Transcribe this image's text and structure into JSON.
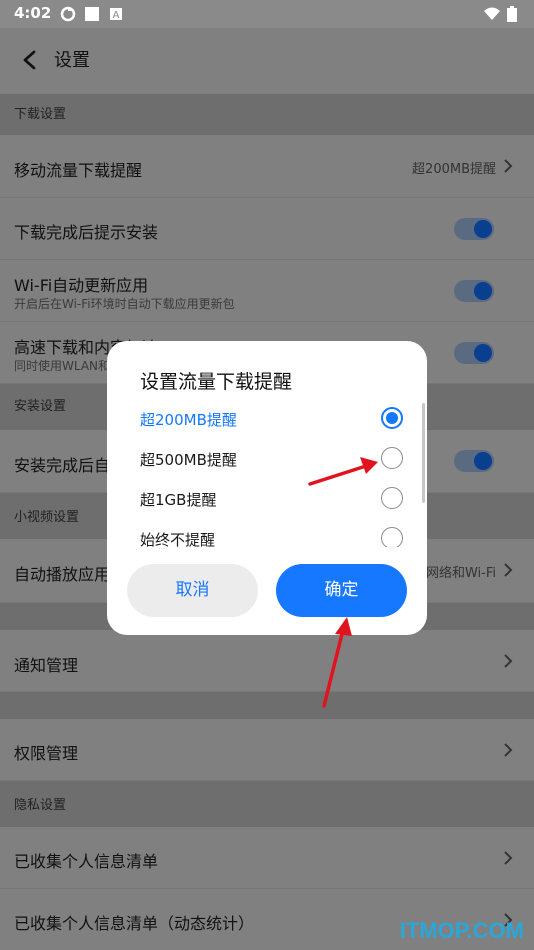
{
  "status_bar": {
    "time": "4:02",
    "icons": [
      "sync-icon",
      "square-icon",
      "a-icon",
      "wifi-icon",
      "battery-icon"
    ]
  },
  "header": {
    "title": "设置"
  },
  "sections": {
    "download": "下载设置",
    "install": "安装设置",
    "video": "小视频设置",
    "privacy": "隐私设置"
  },
  "rows": {
    "mobile_data": {
      "label": "移动流量下载提醒",
      "value": "超200MB提醒"
    },
    "prompt_install": {
      "label": "下载完成后提示安装"
    },
    "wifi_update": {
      "label": "Wi-Fi自动更新应用",
      "sub": "开启后在Wi-Fi环境时自动下载应用更新包"
    },
    "high_speed": {
      "label": "高速下载和内容加速",
      "sub": "同时使用WLAN和移动网络"
    },
    "install_done": {
      "label": "安装完成后自动删除安装包"
    },
    "autoplay": {
      "label": "自动播放应用",
      "value": "移动网络和Wi-Fi"
    },
    "notify": {
      "label": "通知管理"
    },
    "permission": {
      "label": "权限管理"
    },
    "personal_info": {
      "label": "已收集个人信息清单"
    },
    "personal_info_stats": {
      "label": "已收集个人信息清单（动态统计）"
    }
  },
  "dialog": {
    "title": "设置流量下载提醒",
    "options": [
      "超200MB提醒",
      "超500MB提醒",
      "超1GB提醒",
      "始终不提醒"
    ],
    "selected_index": 0,
    "cancel_label": "取消",
    "confirm_label": "确定"
  },
  "watermark": "ITMOP.COM",
  "colors": {
    "accent": "#1677ff",
    "annotation": "#e0141e"
  }
}
